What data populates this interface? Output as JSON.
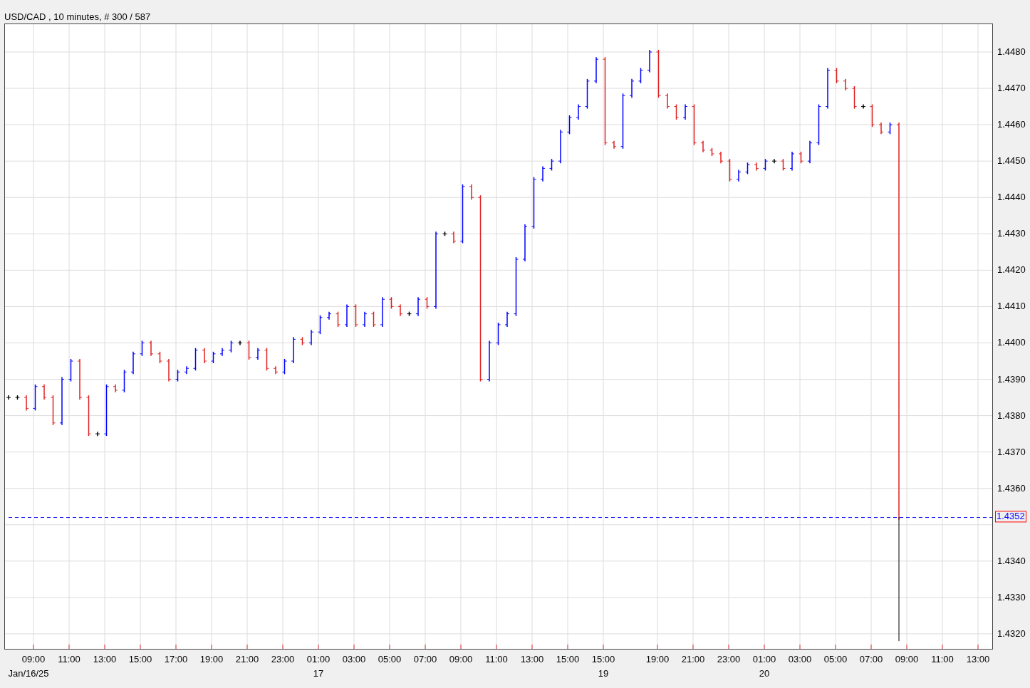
{
  "title_bar": {
    "title": "USD/CAD , 10 minutes, # 300 / 587"
  },
  "chart": {
    "y_axis_labels": [
      "1.4480",
      "1.4470",
      "1.4460",
      "1.4450",
      "1.4440",
      "1.4430",
      "1.4420",
      "1.4410",
      "1.4400",
      "1.4390",
      "1.4380",
      "1.4370",
      "1.4360",
      "1.4340",
      "1.4330",
      "1.4320"
    ],
    "last_price": {
      "label": "1.4352"
    },
    "x_axis_labels": [
      "09:00",
      "11:00",
      "13:00",
      "15:00",
      "17:00",
      "19:00",
      "21:00",
      "23:00",
      "01:00",
      "03:00",
      "05:00",
      "07:00",
      "09:00",
      "11:00",
      "13:00",
      "15:00",
      "15:00",
      "19:00",
      "21:00",
      "23:00",
      "01:00",
      "03:00",
      "05:00",
      "07:00",
      "09:00",
      "11:00",
      "13:00"
    ],
    "date_labels": [
      "Jan/16/25",
      "17",
      "19",
      "20"
    ]
  }
}
